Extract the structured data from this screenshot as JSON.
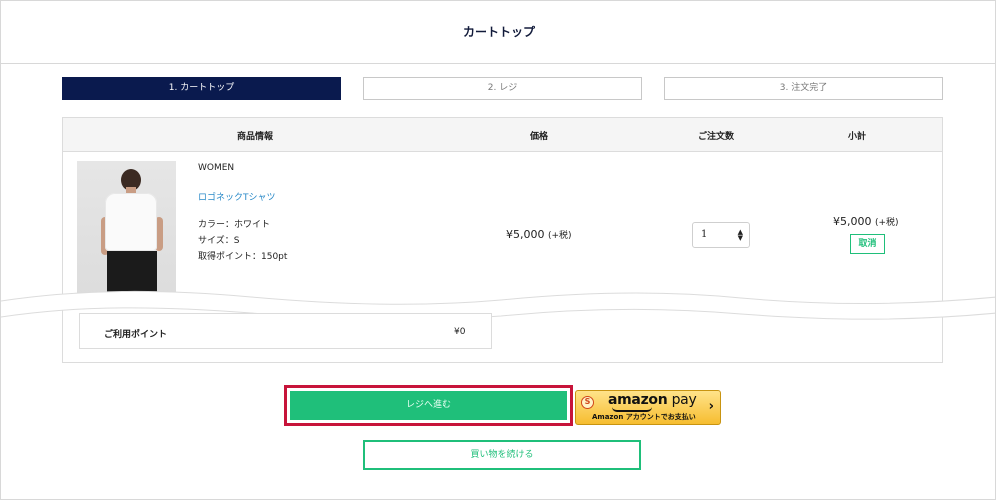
{
  "header": {
    "title": "カートトップ"
  },
  "steps": [
    {
      "label": "1. カートトップ",
      "active": true
    },
    {
      "label": "2. レジ",
      "active": false
    },
    {
      "label": "3. 注文完了",
      "active": false
    }
  ],
  "table": {
    "headers": {
      "product": "商品情報",
      "price": "価格",
      "quantity": "ご注文数",
      "subtotal": "小計"
    }
  },
  "item": {
    "brand": "WOMEN",
    "name": "ロゴネックTシャツ",
    "color": "カラー：ホワイト",
    "size": "サイズ：S",
    "points": "取得ポイント：150pt",
    "price": "¥5,000",
    "price_tax": "(+税)",
    "quantity": "1",
    "subtotal": "¥5,000",
    "subtotal_tax": "(+税)",
    "cancel_label": "取消"
  },
  "points_used": {
    "label": "ご利用ポイント",
    "value": "¥0"
  },
  "actions": {
    "checkout_label": "レジへ進む",
    "amazon_logo_main": "amazon",
    "amazon_logo_pay": " pay",
    "amazon_sub": "Amazon アカウントでお支払い",
    "amazon_coin": "S",
    "continue_label": "買い物を続ける"
  },
  "colors": {
    "navy": "#0a1a4e",
    "green": "#1fbf7a",
    "highlight": "#c7143a",
    "link": "#2a8ac8"
  }
}
